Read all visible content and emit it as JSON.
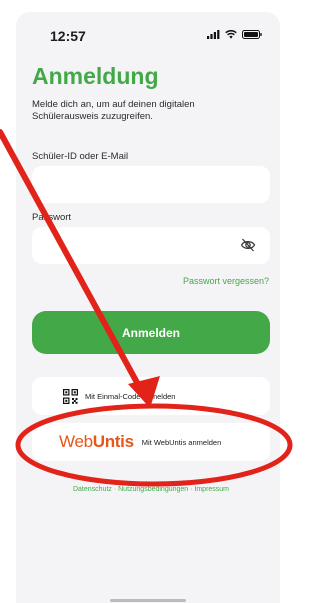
{
  "status_bar": {
    "time": "12:57"
  },
  "header": {
    "title": "Anmeldung",
    "subtitle": "Melde dich an, um auf deinen digitalen Schülerausweis zuzugreifen."
  },
  "form": {
    "id_label": "Schüler-ID oder E-Mail",
    "id_value": "",
    "password_label": "Passwort",
    "password_value": "",
    "forgot_password": "Passwort vergessen?",
    "submit_label": "Anmelden"
  },
  "alt_logins": {
    "code_login": "Mit Einmal-Code anmelden",
    "webuntis_brand_web": "Web",
    "webuntis_brand_untis": "Untis",
    "webuntis_login": "Mit WebUntis anmelden"
  },
  "footer": {
    "links": "Datenschutz · Nutzungsbedingungen · Impressum"
  },
  "colors": {
    "accent": "#43a948",
    "webuntis": "#e8561b",
    "annotation": "#e2231a"
  },
  "icons": [
    "signal-icon",
    "wifi-icon",
    "battery-icon",
    "eye-slash-icon",
    "qr-code-icon"
  ]
}
